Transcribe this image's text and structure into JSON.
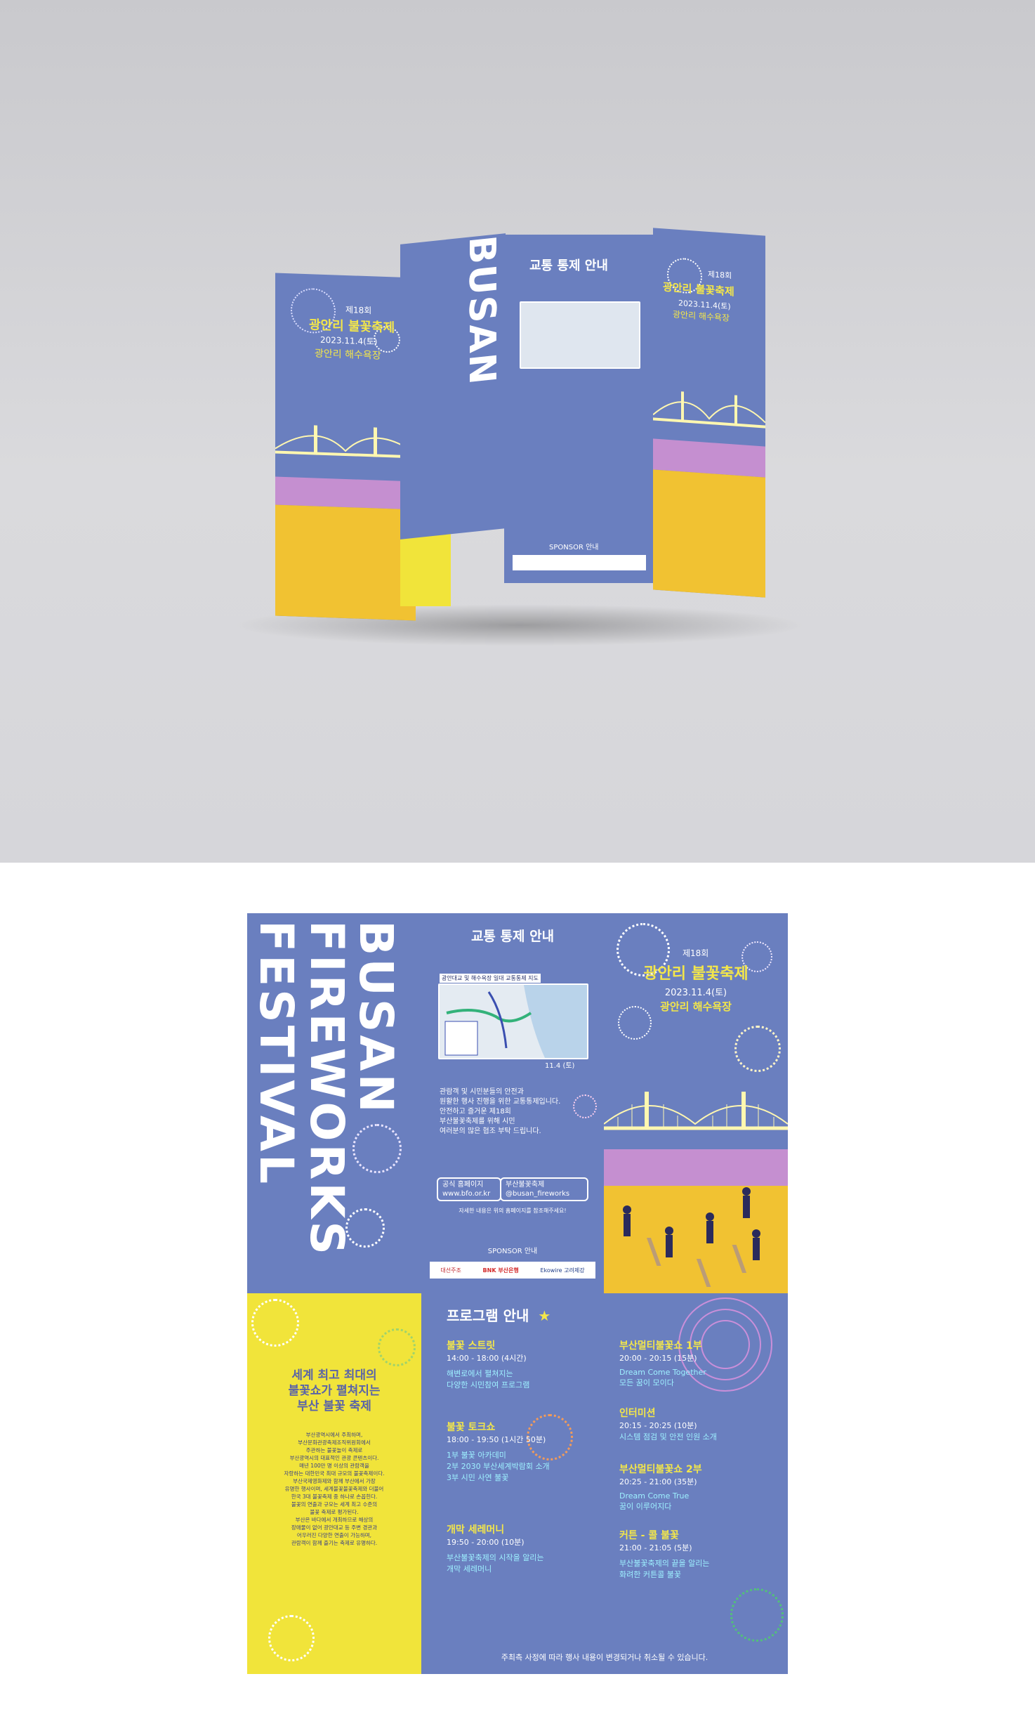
{
  "front": {
    "edition": "제18회",
    "title": "광안리 불꽃축제",
    "date": "2023.11.4(토)",
    "venue": "광안리 해수욕장"
  },
  "spine": {
    "line1": "BUSAN",
    "line2": "FIREWORKS",
    "line3": "FESTIVAL"
  },
  "traffic": {
    "title": "교통 통제 안내",
    "map_caption": "광안대교 및 해수욕장 일대 교통통제 지도",
    "map_date": "11.4 (토)",
    "notice_lines": [
      "관람객 및 시민분들의 안전과",
      "원활한 행사 진행을 위한 교통통제입니다.",
      "안전하고 즐거운 제18회",
      "부산불꽃축제를 위해 시민",
      "여러분의 많은 협조 부탁 드립니다."
    ],
    "link1_label": "공식 홈페이지",
    "link1_value": "www.bfo.or.kr",
    "link2_label": "부산불꽃축제",
    "link2_value": "@busan_fireworks",
    "link_note": "자세한 내용은 위의 홈페이지를 참조해주세요!",
    "sponsor_title": "SPONSOR 안내",
    "sponsors": [
      "대선주조",
      "BNK 부산은행",
      "Ekowire 고려제강"
    ]
  },
  "intro": {
    "headline1": "세계 최고 최대의",
    "headline2": "불꽃쇼가 펼쳐지는",
    "headline3": "부산 불꽃 축제",
    "body_lines": [
      "부산광역시에서 주최하며,",
      "부산문화관광축제조직위원회에서",
      "주관하는 불꽃놀이 축제로",
      "부산광역시의 대표적인 관광 콘텐츠이다.",
      "매년 100만 명 이상의 관람객을",
      "자랑하는 대한민국 최대 규모의 불꽃축제이다.",
      "부산국제영화제와 함께 부산에서 가장",
      "유명한 행사이며, 세계불꽃불꽃축제와 더불어",
      "한국 3대 불꽃축제 중 하나로 손꼽힌다.",
      "불꽃의 연출과 규모는 세계 최고 수준의",
      "불꽃 축제로 평가된다.",
      "부산은 바다에서 개최하므로 해상의",
      "장애물이 없어 광안대교 등 주변 경관과",
      "어우러진 다양한 연출이 가능하며,",
      "관람객이 함께 즐기는 축제로 유명하다."
    ]
  },
  "program": {
    "title": "프로그램 안내",
    "star": "★",
    "items_left": [
      {
        "name": "불꽃 스트릿",
        "time": "14:00 - 18:00 (4시간)",
        "desc": [
          "해변로에서 펼쳐지는",
          "다양한 시민참여 프로그램"
        ]
      },
      {
        "name": "불꽃 토크쇼",
        "time": "18:00 - 19:50 (1시간 50분)",
        "desc": [
          "1부 불꽃 아카데미",
          "2부 2030 부산세계박람회 소개",
          "3부 시민 사연 불꽃"
        ]
      },
      {
        "name": "개막 세레머니",
        "time": "19:50 - 20:00 (10분)",
        "desc": [
          "부산불꽃축제의 시작을 알리는",
          "개막 세레머니"
        ]
      }
    ],
    "items_right": [
      {
        "name": "부산멀티불꽃쇼 1부",
        "time": "20:00 - 20:15 (15분)",
        "desc": [
          "Dream Come Together",
          "모든 꿈이 모이다"
        ]
      },
      {
        "name": "인터미션",
        "time": "20:15 - 20:25 (10분)",
        "desc": [
          "시스템 점검 및 안전 인원 소개"
        ]
      },
      {
        "name": "부산멀티불꽃쇼 2부",
        "time": "20:25 - 21:00 (35분)",
        "desc": [
          "Dream Come True",
          "꿈이 이루어지다"
        ]
      },
      {
        "name": "커튼 - 콜 불꽃",
        "time": "21:00 - 21:05 (5분)",
        "desc": [
          "부산불꽃축제의 끝을 알리는",
          "화려한 커튼콜 불꽃"
        ]
      }
    ],
    "footer": "주최측 사정에 따라 행사 내용이 변경되거나 취소될 수 있습니다."
  },
  "colors": {
    "blue": "#6a7fbf",
    "yellow": "#f1e43a",
    "sand": "#f1c232",
    "purple_band": "#c58fd0",
    "navy_text": "#26306a"
  }
}
